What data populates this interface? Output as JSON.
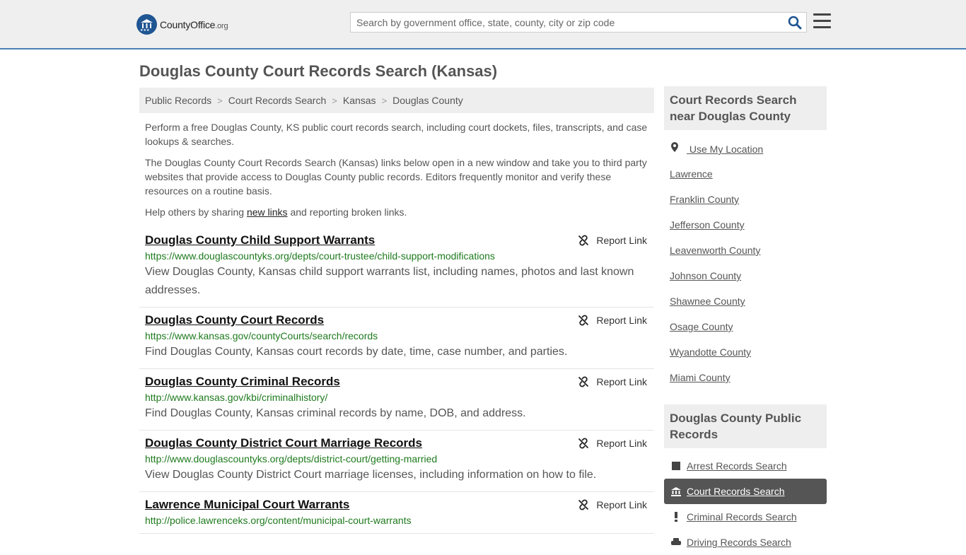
{
  "header": {
    "logo_main": "CountyOffice",
    "logo_tld": ".org",
    "search_placeholder": "Search by government office, state, county, city or zip code"
  },
  "page": {
    "title": "Douglas County Court Records Search (Kansas)",
    "breadcrumb": [
      "Public Records",
      "Court Records Search",
      "Kansas",
      "Douglas County"
    ]
  },
  "intro": {
    "p1": "Perform a free Douglas County, KS public court records search, including court dockets, files, transcripts, and case lookups & searches.",
    "p2": "The Douglas County Court Records Search (Kansas) links below open in a new window and take you to third party websites that provide access to Douglas County public records. Editors frequently monitor and verify these resources on a routine basis.",
    "p3_before": "Help others by sharing ",
    "p3_link": "new links",
    "p3_after": " and reporting broken links."
  },
  "report_label": "Report Link",
  "listings": [
    {
      "title": "Douglas County Child Support Warrants",
      "url": "https://www.douglascountyks.org/depts/court-trustee/child-support-modifications",
      "desc": "View Douglas County, Kansas child support warrants list, including names, photos and last known addresses."
    },
    {
      "title": "Douglas County Court Records",
      "url": "https://www.kansas.gov/countyCourts/search/records",
      "desc": "Find Douglas County, Kansas court records by date, time, case number, and parties."
    },
    {
      "title": "Douglas County Criminal Records",
      "url": "http://www.kansas.gov/kbi/criminalhistory/",
      "desc": "Find Douglas County, Kansas criminal records by name, DOB, and address."
    },
    {
      "title": "Douglas County District Court Marriage Records",
      "url": "http://www.douglascountyks.org/depts/district-court/getting-married",
      "desc": "View Douglas County District Court marriage licenses, including information on how to file."
    },
    {
      "title": "Lawrence Municipal Court Warrants",
      "url": "http://police.lawrenceks.org/content/municipal-court-warrants",
      "desc": ""
    }
  ],
  "sidebar": {
    "near_heading": "Court Records Search near Douglas County",
    "use_location": "Use My Location",
    "near_links": [
      "Lawrence",
      "Franklin County",
      "Jefferson County",
      "Leavenworth County",
      "Johnson County",
      "Shawnee County",
      "Osage County",
      "Wyandotte County",
      "Miami County"
    ],
    "pr_heading": "Douglas County Public Records",
    "pr_links": [
      "Arrest Records Search",
      "Court Records Search",
      "Criminal Records Search",
      "Driving Records Search"
    ],
    "pr_active_index": 1
  },
  "colors": {
    "accent_border": "#4a7fb5",
    "url_green": "#1e7a1e",
    "active_bg": "#555555"
  }
}
